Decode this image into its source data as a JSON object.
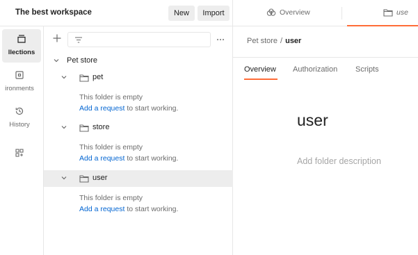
{
  "workspace": {
    "title": "The best workspace",
    "new_label": "New",
    "import_label": "Import"
  },
  "rail": {
    "items": [
      {
        "label": "Collections",
        "visible_label": "llections",
        "icon": "collections-icon",
        "active": true
      },
      {
        "label": "Environments",
        "visible_label": "ironments",
        "icon": "environments-icon",
        "active": false
      },
      {
        "label": "History",
        "visible_label": "History",
        "icon": "history-icon",
        "active": false
      },
      {
        "label": "",
        "visible_label": "",
        "icon": "add-apps-icon",
        "active": false
      }
    ]
  },
  "tree": {
    "collection": "Pet store",
    "folders": [
      {
        "name": "pet",
        "empty_text": "This folder is empty",
        "add_link": "Add a request",
        "suffix": "to start working.",
        "selected": false
      },
      {
        "name": "store",
        "empty_text": "This folder is empty",
        "add_link": "Add a request",
        "suffix": "to start working.",
        "selected": false
      },
      {
        "name": "user",
        "empty_text": "This folder is empty",
        "add_link": "Add a request",
        "suffix": "to start working.",
        "selected": true
      }
    ]
  },
  "tabs": {
    "overview_label": "Overview",
    "user_label": "use"
  },
  "breadcrumb": {
    "parent": "Pet store",
    "separator": "/",
    "current": "user"
  },
  "folder_tabs": {
    "overview": "Overview",
    "authorization": "Authorization",
    "scripts": "Scripts"
  },
  "folder": {
    "title": "user",
    "description_placeholder": "Add folder description"
  },
  "colors": {
    "accent": "#ff6c37",
    "link": "#0265d2",
    "selected_bg": "#ededed",
    "border": "#e6e6e6"
  }
}
